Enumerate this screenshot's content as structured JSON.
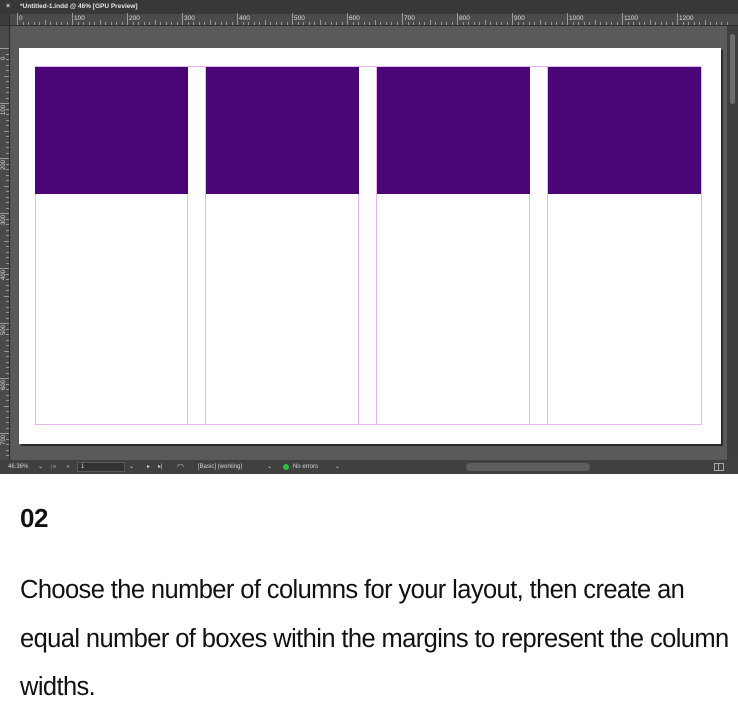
{
  "window": {
    "close_glyph": "×",
    "document_tab": "*Untitled-1.indd @ 46% [GPU Preview]"
  },
  "rulers": {
    "horizontal_labels": [
      "0",
      "100",
      "200",
      "300",
      "400",
      "500",
      "600",
      "700",
      "800",
      "900",
      "1000",
      "1100",
      "1200"
    ],
    "vertical_labels": [
      "0",
      "100",
      "200",
      "300",
      "400",
      "500",
      "600",
      "700"
    ]
  },
  "document": {
    "column_count": 4,
    "box_color": "#4a0676",
    "margin_guide_color": "#e7b6f0",
    "page_color": "#ffffff",
    "pasteboard_color": "#5a5a5a"
  },
  "statusbar": {
    "zoom": "46.36%",
    "zoom_chevron": "⌄",
    "first_page": "|◂",
    "prev_page": "◂",
    "page_number": "1",
    "page_chevron": "⌄",
    "next_page": "▸",
    "last_page": "▸|",
    "preflight_icon": "◠",
    "style": "[Basic] (working)",
    "style_chevron": "⌄",
    "preflight_status": "No errors",
    "preflight_chevron": "⌄",
    "status_ok_color": "#2fbf3e"
  },
  "caption": {
    "step": "02",
    "text": "Choose the number of columns for your layout, then create an equal number of boxes within the margins to represent the column widths."
  }
}
